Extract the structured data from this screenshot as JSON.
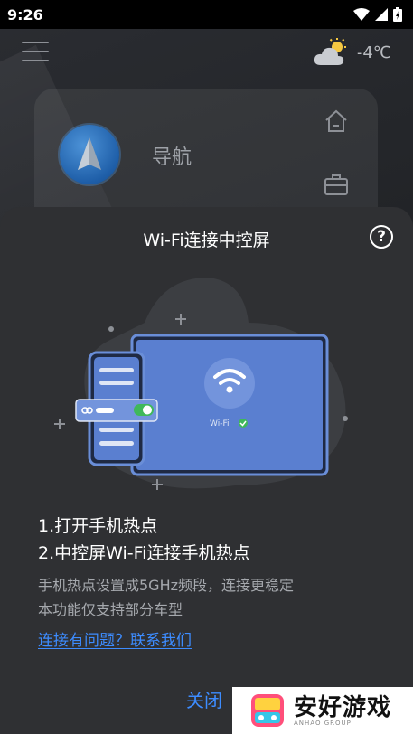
{
  "status_bar": {
    "time": "9:26"
  },
  "weather": {
    "temperature": "-4℃"
  },
  "nav_card": {
    "label": "导航"
  },
  "sheet": {
    "title": "Wi-Fi连接中控屏",
    "illustration": {
      "wifi_label": "Wi-Fi"
    },
    "steps": [
      "1.打开手机热点",
      "2.中控屏Wi-Fi连接手机热点"
    ],
    "notes": [
      "手机热点设置成5GHz频段，连接更稳定",
      "本功能仅支持部分车型"
    ],
    "contact_link": "连接有问题？联系我们",
    "close_button": "关闭"
  },
  "watermark": {
    "brand": "安好游戏",
    "sub": "ANHAO GROUP"
  },
  "colors": {
    "accent": "#3d8cff",
    "sheet_bg": "#2f3033"
  }
}
